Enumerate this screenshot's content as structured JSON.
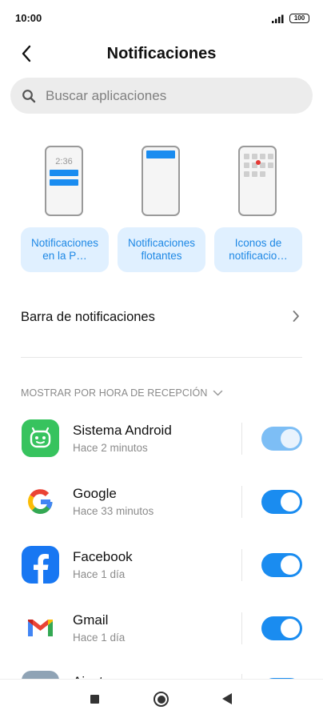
{
  "status_bar": {
    "time": "10:00",
    "battery": "100"
  },
  "header": {
    "title": "Notificaciones"
  },
  "search": {
    "placeholder": "Buscar aplicaciones"
  },
  "styles": [
    {
      "label": "Notificaciones en la P…",
      "preview_time": "2:36"
    },
    {
      "label": "Notificaciones flotantes"
    },
    {
      "label": "Iconos de notificacio…"
    }
  ],
  "notification_bar": {
    "label": "Barra de notificaciones"
  },
  "sort": {
    "label": "MOSTRAR POR HORA DE RECEPCIÓN"
  },
  "apps": [
    {
      "name": "Sistema Android",
      "time": "Hace 2 minutos",
      "enabled": true,
      "locked": true,
      "icon": "android-icon"
    },
    {
      "name": "Google",
      "time": "Hace 33 minutos",
      "enabled": true,
      "icon": "google-icon"
    },
    {
      "name": "Facebook",
      "time": "Hace 1 día",
      "enabled": true,
      "icon": "facebook-icon"
    },
    {
      "name": "Gmail",
      "time": "Hace 1 día",
      "enabled": true,
      "icon": "gmail-icon"
    },
    {
      "name": "Ajustes",
      "time": "",
      "enabled": true,
      "icon": "settings-icon"
    }
  ],
  "colors": {
    "accent": "#1a8cf0",
    "card_bg": "#e0f0ff",
    "search_bg": "#ececec"
  }
}
